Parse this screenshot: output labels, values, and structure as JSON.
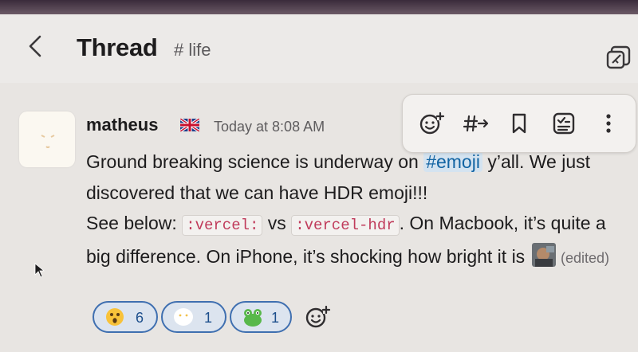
{
  "header": {
    "title": "Thread",
    "channel": "# life"
  },
  "message": {
    "author": "matheus",
    "timestamp": "Today at 8:08 AM",
    "text_before_mention": "Ground breaking science is underway on ",
    "mention": "#emoji",
    "text_after_mention": " y’all. We just discovered that we can have HDR emoji!!!",
    "see_below": "See below: ",
    "code_1": ":vercel:",
    "vs": " vs ",
    "code_2": ":vercel-hdr",
    "text_after_codes": ". On Macbook, it’s quite a big difference. On iPhone, it’s shocking how bright it is ",
    "edited": "(edited)"
  },
  "reactions": [
    {
      "icon": "astonished-face-icon",
      "count": "6"
    },
    {
      "icon": "vercel-emoji-icon",
      "count": "1"
    },
    {
      "icon": "frog-emoji-icon",
      "count": "1"
    }
  ],
  "toolbar": {
    "icons": [
      "add-reaction-icon",
      "reply-in-thread-icon",
      "bookmark-icon",
      "mark-unread-icon",
      "more-actions-icon"
    ]
  },
  "colors": {
    "accent_blue": "#1264a3",
    "code_red": "#c03b5b",
    "reaction_border": "#3f6fb0"
  }
}
